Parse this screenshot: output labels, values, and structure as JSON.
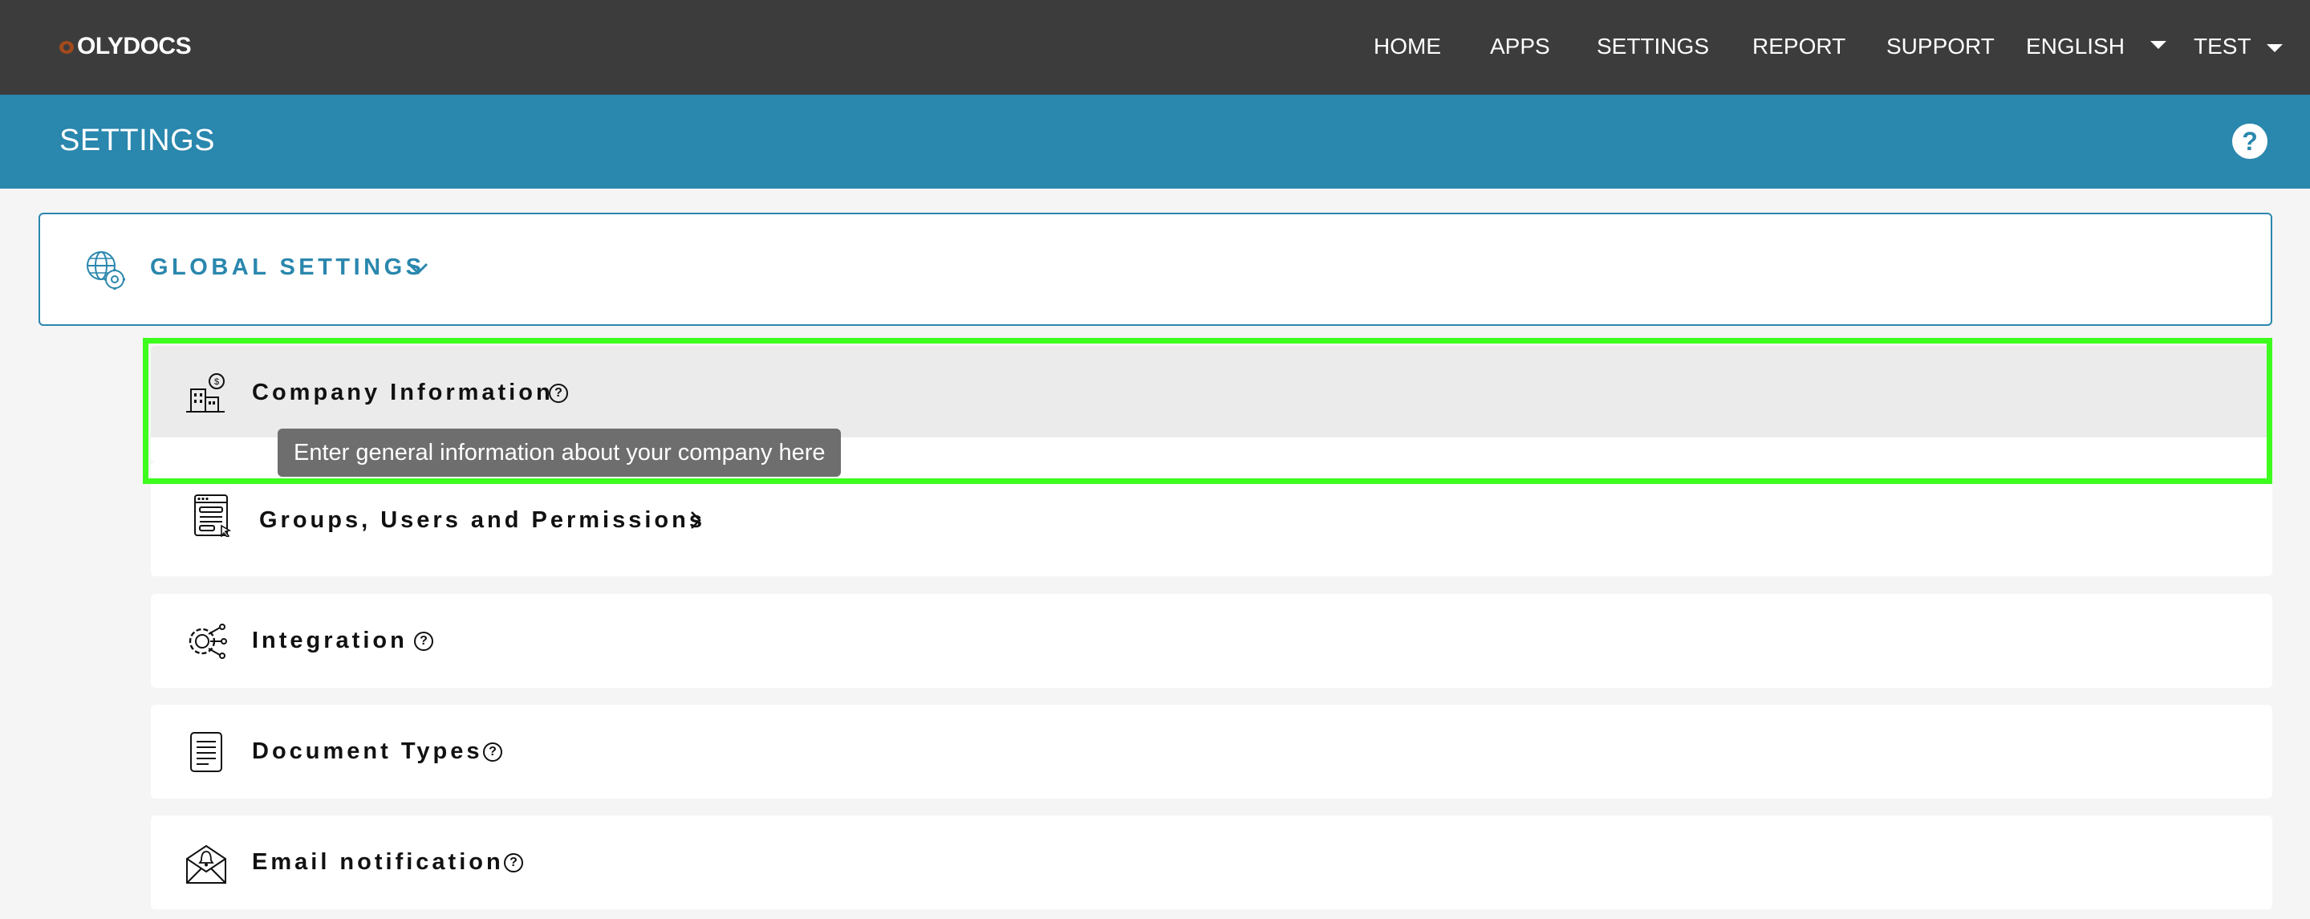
{
  "app": {
    "logo_text": "OLYDOCS"
  },
  "nav": {
    "items": [
      {
        "label": "HOME"
      },
      {
        "label": "APPS"
      },
      {
        "label": "SETTINGS"
      },
      {
        "label": "REPORT"
      },
      {
        "label": "SUPPORT"
      }
    ],
    "language": "ENGLISH",
    "user": "TEST"
  },
  "header": {
    "title": "SETTINGS",
    "help": "?"
  },
  "global_settings": {
    "label": "GLOBAL SETTINGS"
  },
  "rows": [
    {
      "label": "Company Information",
      "icon": "company-building-icon",
      "help": "?"
    },
    {
      "label": "Groups, Users and Permissions",
      "icon": "user-permissions-icon"
    },
    {
      "label": "Integration",
      "icon": "integration-gear-icon",
      "help": "?"
    },
    {
      "label": "Document Types",
      "icon": "document-icon",
      "help": "?"
    },
    {
      "label": "Email notification",
      "icon": "email-notification-icon",
      "help": "?"
    }
  ],
  "tooltip": {
    "text": "Enter general information about your company here"
  },
  "colors": {
    "topnav": "#3c3c3c",
    "header": "#2a87ad",
    "accent": "#2a87ad",
    "highlight": "#3dfc1e",
    "tooltip": "#6e6e6e"
  }
}
